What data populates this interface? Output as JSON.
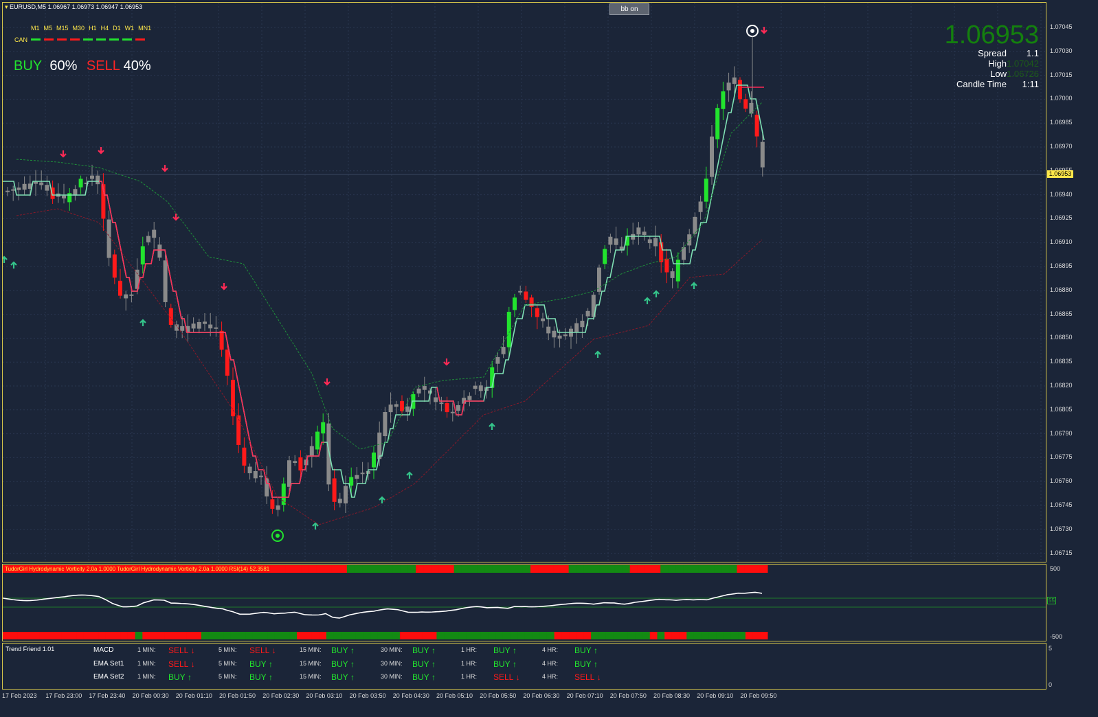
{
  "header": {
    "symbol_line": "EURUSD,M5  1.06967 1.06973 1.06947 1.06953",
    "bb_button": "bb on",
    "timeframes": [
      "M1",
      "M5",
      "M15",
      "M30",
      "H1",
      "H4",
      "D1",
      "W1",
      "MN1"
    ],
    "can_label": "CAN",
    "can_states": [
      "buy",
      "sell",
      "sell",
      "sell",
      "buy",
      "buy",
      "buy",
      "buy",
      "sell"
    ]
  },
  "signal": {
    "buy_label": "BUY",
    "buy_pct": "60%",
    "sell_label": "SELL",
    "sell_pct": "40%"
  },
  "info": {
    "price": "1.06953",
    "spread_label": "Spread",
    "spread_value": "1.1",
    "high_label": "High",
    "high_value": "1.07042",
    "low_label": "Low",
    "low_value": "1.06726",
    "candle_time_label": "Candle Time",
    "candle_time_value": "1:11"
  },
  "price_axis": {
    "labels": [
      "1.07045",
      "1.07030",
      "1.07015",
      "1.07000",
      "1.06985",
      "1.06970",
      "1.06955",
      "1.06940",
      "1.06925",
      "1.06910",
      "1.06895",
      "1.06880",
      "1.06865",
      "1.06850",
      "1.06835",
      "1.06820",
      "1.06805",
      "1.06790",
      "1.06775",
      "1.06760",
      "1.06745",
      "1.06730",
      "1.06715"
    ],
    "current": "1.06953"
  },
  "rsi_panel": {
    "caption1": "TudorGirl Hydrodynamic Vorticity 2.0a 1.0000",
    "caption2": "TudorGirl Hydrodynamic Vorticity 2.0a 1.0000",
    "caption3": "RSI(14) 52.3581",
    "axis_top": "500",
    "axis_bottom": "-500",
    "axis_mid": "55",
    "top_bar": [
      "r",
      "r",
      "r",
      "r",
      "r",
      "r",
      "r",
      "r",
      "r",
      "r",
      "r",
      "r",
      "r",
      "r",
      "r",
      "r",
      "r",
      "r",
      "r",
      "r",
      "r",
      "r",
      "r",
      "r",
      "r",
      "r",
      "r",
      "r",
      "r",
      "r",
      "r",
      "r",
      "r",
      "r",
      "r",
      "r",
      "r",
      "r",
      "r",
      "r",
      "r",
      "r",
      "r",
      "r",
      "r",
      "g",
      "g",
      "g",
      "g",
      "g",
      "g",
      "g",
      "g",
      "g",
      "r",
      "r",
      "r",
      "r",
      "r",
      "g",
      "g",
      "g",
      "g",
      "g",
      "g",
      "g",
      "g",
      "g",
      "g",
      "r",
      "r",
      "r",
      "r",
      "r",
      "g",
      "g",
      "g",
      "g",
      "g",
      "g",
      "g",
      "g",
      "r",
      "r",
      "r",
      "r",
      "g",
      "g",
      "g",
      "g",
      "g",
      "g",
      "g",
      "g",
      "g",
      "g",
      "r",
      "r",
      "r",
      "r"
    ],
    "bottom_bar": [
      "r",
      "r",
      "r",
      "r",
      "r",
      "r",
      "r",
      "r",
      "r",
      "r",
      "r",
      "r",
      "r",
      "r",
      "r",
      "r",
      "r",
      "r",
      "g",
      "r",
      "r",
      "r",
      "r",
      "r",
      "r",
      "r",
      "r",
      "g",
      "g",
      "g",
      "g",
      "g",
      "g",
      "g",
      "g",
      "g",
      "g",
      "g",
      "g",
      "g",
      "r",
      "r",
      "r",
      "r",
      "g",
      "g",
      "g",
      "g",
      "g",
      "g",
      "g",
      "g",
      "g",
      "g",
      "r",
      "r",
      "r",
      "r",
      "r",
      "g",
      "g",
      "g",
      "g",
      "g",
      "g",
      "g",
      "g",
      "g",
      "g",
      "g",
      "g",
      "g",
      "g",
      "g",
      "g",
      "r",
      "r",
      "r",
      "r",
      "r",
      "g",
      "g",
      "g",
      "g",
      "g",
      "g",
      "g",
      "g",
      "r",
      "g",
      "r",
      "r",
      "r",
      "g",
      "g",
      "g",
      "g",
      "g",
      "g",
      "g",
      "g",
      "r",
      "r",
      "r"
    ]
  },
  "trend_friend": {
    "title": "Trend Friend 1.01",
    "axis_top": "5",
    "axis_bottom": "0",
    "rows": [
      {
        "name": "MACD",
        "cells": [
          {
            "tf": "1 MIN:",
            "sig": "SELL",
            "arrow": "↓"
          },
          {
            "tf": "5 MIN:",
            "sig": "SELL",
            "arrow": "↓"
          },
          {
            "tf": "15 MIN:",
            "sig": "BUY",
            "arrow": "↑"
          },
          {
            "tf": "30 MIN:",
            "sig": "BUY",
            "arrow": "↑"
          },
          {
            "tf": "1 HR:",
            "sig": "BUY",
            "arrow": "↑"
          },
          {
            "tf": "4 HR:",
            "sig": "BUY",
            "arrow": "↑"
          }
        ]
      },
      {
        "name": "EMA Set1",
        "cells": [
          {
            "tf": "1 MIN:",
            "sig": "SELL",
            "arrow": "↓"
          },
          {
            "tf": "5 MIN:",
            "sig": "BUY",
            "arrow": "↑"
          },
          {
            "tf": "15 MIN:",
            "sig": "BUY",
            "arrow": "↑"
          },
          {
            "tf": "30 MIN:",
            "sig": "BUY",
            "arrow": "↑"
          },
          {
            "tf": "1 HR:",
            "sig": "BUY",
            "arrow": "↑"
          },
          {
            "tf": "4 HR:",
            "sig": "BUY",
            "arrow": "↑"
          }
        ]
      },
      {
        "name": "EMA Set2",
        "cells": [
          {
            "tf": "1 MIN:",
            "sig": "BUY",
            "arrow": "↑"
          },
          {
            "tf": "5 MIN:",
            "sig": "BUY",
            "arrow": "↑"
          },
          {
            "tf": "15 MIN:",
            "sig": "BUY",
            "arrow": "↑"
          },
          {
            "tf": "30 MIN:",
            "sig": "BUY",
            "arrow": "↑"
          },
          {
            "tf": "1 HR:",
            "sig": "SELL",
            "arrow": "↓"
          },
          {
            "tf": "4 HR:",
            "sig": "SELL",
            "arrow": "↓"
          }
        ]
      }
    ]
  },
  "time_axis": [
    "17 Feb 2023",
    "17 Feb 23:00",
    "17 Feb 23:40",
    "20 Feb 00:30",
    "20 Feb 01:10",
    "20 Feb 01:50",
    "20 Feb 02:30",
    "20 Feb 03:10",
    "20 Feb 03:50",
    "20 Feb 04:30",
    "20 Feb 05:10",
    "20 Feb 05:50",
    "20 Feb 06:30",
    "20 Feb 07:10",
    "20 Feb 07:50",
    "20 Feb 08:30",
    "20 Feb 09:10",
    "20 Feb 09:50"
  ],
  "colors": {
    "bg": "#1b2538",
    "bull": "#22e32e",
    "bear": "#ff1a1a",
    "neutral": "#8a8a8a",
    "border": "#d4c44a"
  }
}
